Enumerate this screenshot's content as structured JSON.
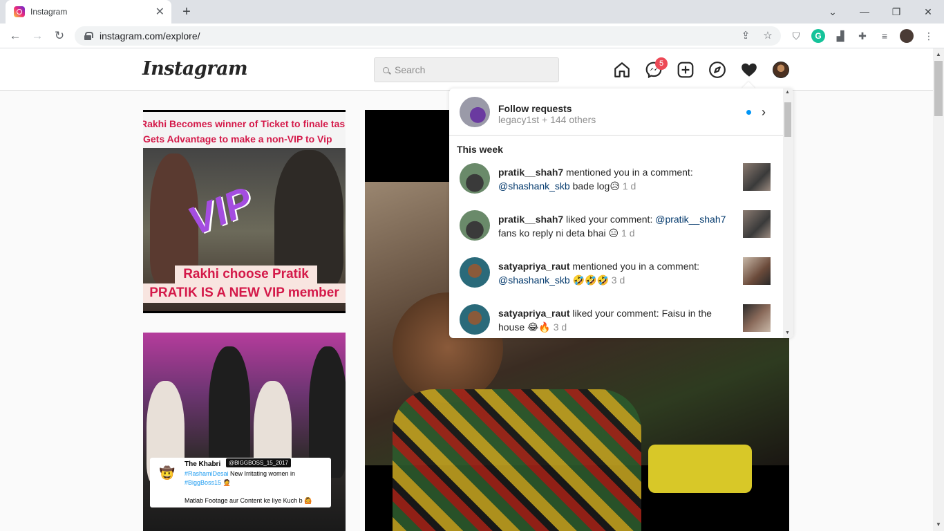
{
  "browser": {
    "tab_title": "Instagram",
    "tab_close": "✕",
    "new_tab": "+",
    "url": "instagram.com/explore/",
    "window_controls": [
      "minimize",
      "restore",
      "close"
    ]
  },
  "instagram": {
    "logo": "Instagram",
    "search_placeholder": "Search",
    "messenger_badge": "5",
    "nav_icons": [
      "home-icon",
      "messenger-icon",
      "new-post-icon",
      "explore-icon",
      "activity-heart-icon",
      "profile-avatar"
    ]
  },
  "tiles": {
    "tile1": {
      "headline1": "Rakhi Becomes winner of Ticket to finale task",
      "headline2": "Gets Advantage to make a non-VIP to Vip",
      "overlay": "VIP",
      "caption1": "Rakhi choose Pratik",
      "caption2": "PRATIK IS A NEW VIP member"
    },
    "tile2": {
      "tweet_name": "The Khabri",
      "tweet_tag": "@BIGGBOSS_15_2017",
      "tweet_hash1": "#RashamiDesai",
      "tweet_line1": " New Irritating women in",
      "tweet_hash2": "#BiggBoss15",
      "tweet_line3": "Matlab Footage aur Content ke liye Kuch b"
    }
  },
  "notifications": {
    "follow_requests": {
      "title": "Follow requests",
      "subtitle": "legacy1st + 144 others"
    },
    "section_title": "This week",
    "items": [
      {
        "user": "pratik__shah7",
        "action": " mentioned you in a comment: ",
        "mention": "@shashank_skb",
        "text": " bade log😥",
        "time": "1 d"
      },
      {
        "user": "pratik__shah7",
        "action": " liked your comment: ",
        "mention": "@pratik__shah7",
        "text": " fans ko reply ni deta bhai 😑",
        "time": "1 d"
      },
      {
        "user": "satyapriya_raut",
        "action": " mentioned you in a comment: ",
        "mention": "@shashank_skb",
        "text": " 🤣🤣🤣",
        "time": "3 d"
      },
      {
        "user": "satyapriya_raut",
        "action": " liked your comment: Faisu in the house ",
        "mention": "",
        "text": "😂🔥",
        "time": "3 d"
      }
    ]
  },
  "colors": {
    "accent_blue": "#0095f6",
    "badge_red": "#ed4956",
    "mention_blue": "#00376b"
  }
}
